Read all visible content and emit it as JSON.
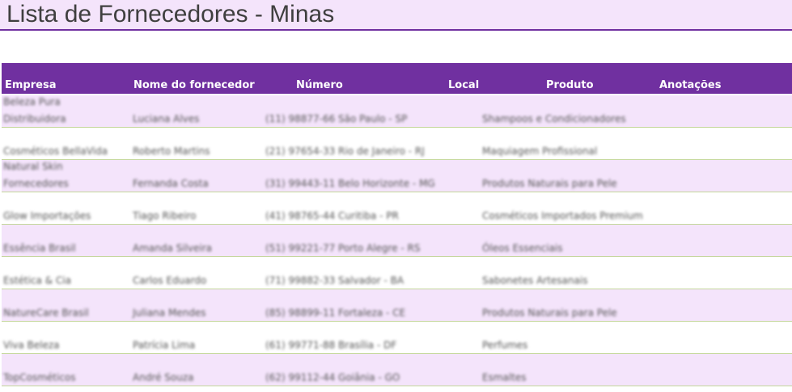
{
  "sheet": {
    "title": "Lista de Fornecedores - Minas"
  },
  "table": {
    "headers": {
      "empresa": "Empresa",
      "nome": "Nome do fornecedor",
      "numero": "Número",
      "local": "Local",
      "produto": "Produto",
      "anotacoes": "Anotações"
    },
    "rows": [
      {
        "empresa_l1": "Beleza Pura",
        "empresa_l2": "Distribuidora",
        "nome": "Luciana Alves",
        "numero_local": "(11) 98877-66 São Paulo - SP",
        "produto": "Shampoos e Condicionadores"
      },
      {
        "empresa_l1": "",
        "empresa_l2": "Cosméticos BellaVida",
        "nome": "Roberto Martins",
        "numero_local": "(21) 97654-33 Rio de Janeiro - RJ",
        "produto": "Maquiagem Profissional"
      },
      {
        "empresa_l1": "Natural Skin",
        "empresa_l2": "Fornecedores",
        "nome": "Fernanda Costa",
        "numero_local": "(31) 99443-11 Belo Horizonte - MG",
        "produto": "Produtos Naturais para Pele"
      },
      {
        "empresa_l1": "",
        "empresa_l2": "Glow Importações",
        "nome": "Tiago Ribeiro",
        "numero_local": "(41) 98765-44 Curitiba - PR",
        "produto": "Cosméticos Importados Premium"
      },
      {
        "empresa_l1": "",
        "empresa_l2": "Essência Brasil",
        "nome": "Amanda Silveira",
        "numero_local": "(51) 99221-77 Porto Alegre - RS",
        "produto": "Óleos Essenciais"
      },
      {
        "empresa_l1": "",
        "empresa_l2": "Estética & Cia",
        "nome": "Carlos Eduardo",
        "numero_local": "(71) 99882-33 Salvador - BA",
        "produto": "Sabonetes Artesanais"
      },
      {
        "empresa_l1": "",
        "empresa_l2": "NatureCare Brasil",
        "nome": "Juliana Mendes",
        "numero_local": "(85) 98899-11 Fortaleza - CE",
        "produto": "Produtos Naturais para Pele"
      },
      {
        "empresa_l1": "",
        "empresa_l2": "Viva Beleza",
        "nome": "Patrícia Lima",
        "numero_local": "(61) 99771-88 Brasília - DF",
        "produto": "Perfumes"
      },
      {
        "empresa_l1": "",
        "empresa_l2": "TopCosméticos",
        "nome": "André Souza",
        "numero_local": "(62) 99112-44 Goiânia - GO",
        "produto": "Esmaltes"
      }
    ]
  },
  "colors": {
    "accent": "#7030a0",
    "row_shade": "#f4e4fb",
    "row_border": "#c4d79b"
  }
}
